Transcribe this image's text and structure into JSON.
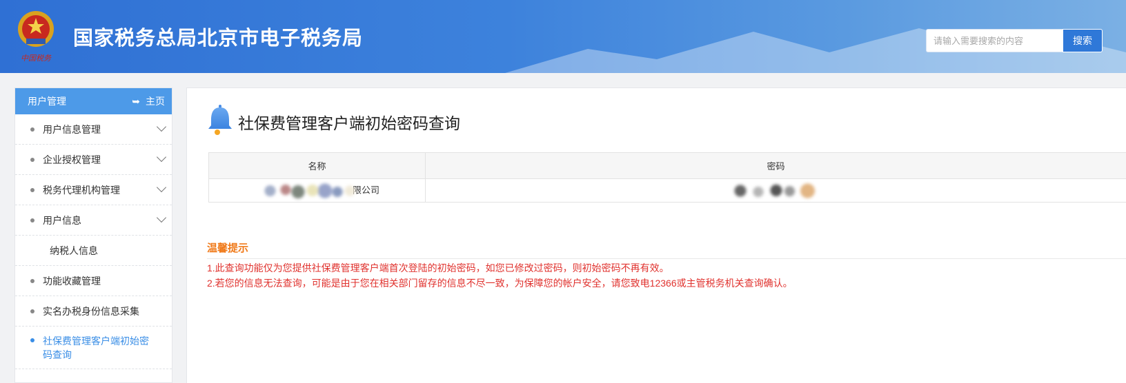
{
  "header": {
    "title": "国家税务总局北京市电子税务局",
    "emblem_caption": "中国税务",
    "search_placeholder": "请输入需要搜索的内容",
    "search_button": "搜索"
  },
  "sidebar": {
    "title": "用户管理",
    "home_label": "主页",
    "items": [
      {
        "label": "用户信息管理",
        "expandable": true
      },
      {
        "label": "企业授权管理",
        "expandable": true
      },
      {
        "label": "税务代理机构管理",
        "expandable": true
      },
      {
        "label": "用户信息",
        "expandable": true
      },
      {
        "label": "纳税人信息",
        "sub": true
      },
      {
        "label": "功能收藏管理"
      },
      {
        "label": "实名办税身份信息采集"
      },
      {
        "label": "社保费管理客户端初始密码查询",
        "active": true
      }
    ]
  },
  "main": {
    "title": "社保费管理客户端初始密码查询",
    "table": {
      "headers": [
        "名称",
        "密码"
      ],
      "rows": [
        {
          "name_visible_suffix": "限公司"
        }
      ]
    },
    "tips": {
      "title": "温馨提示",
      "lines": [
        "1.此查询功能仅为您提供社保费管理客户端首次登陆的初始密码，如您已修改过密码，则初始密码不再有效。",
        "2.若您的信息无法查询，可能是由于您在相关部门留存的信息不尽一致，为保障您的帐户安全，请您致电12366或主管税务机关查询确认。"
      ]
    }
  },
  "colors": {
    "header_blue": "#2f70d4",
    "sidebar_head": "#4d9ae8",
    "active_link": "#3a8ee6",
    "tip_orange": "#f07a1a",
    "tip_red": "#e0322e"
  }
}
